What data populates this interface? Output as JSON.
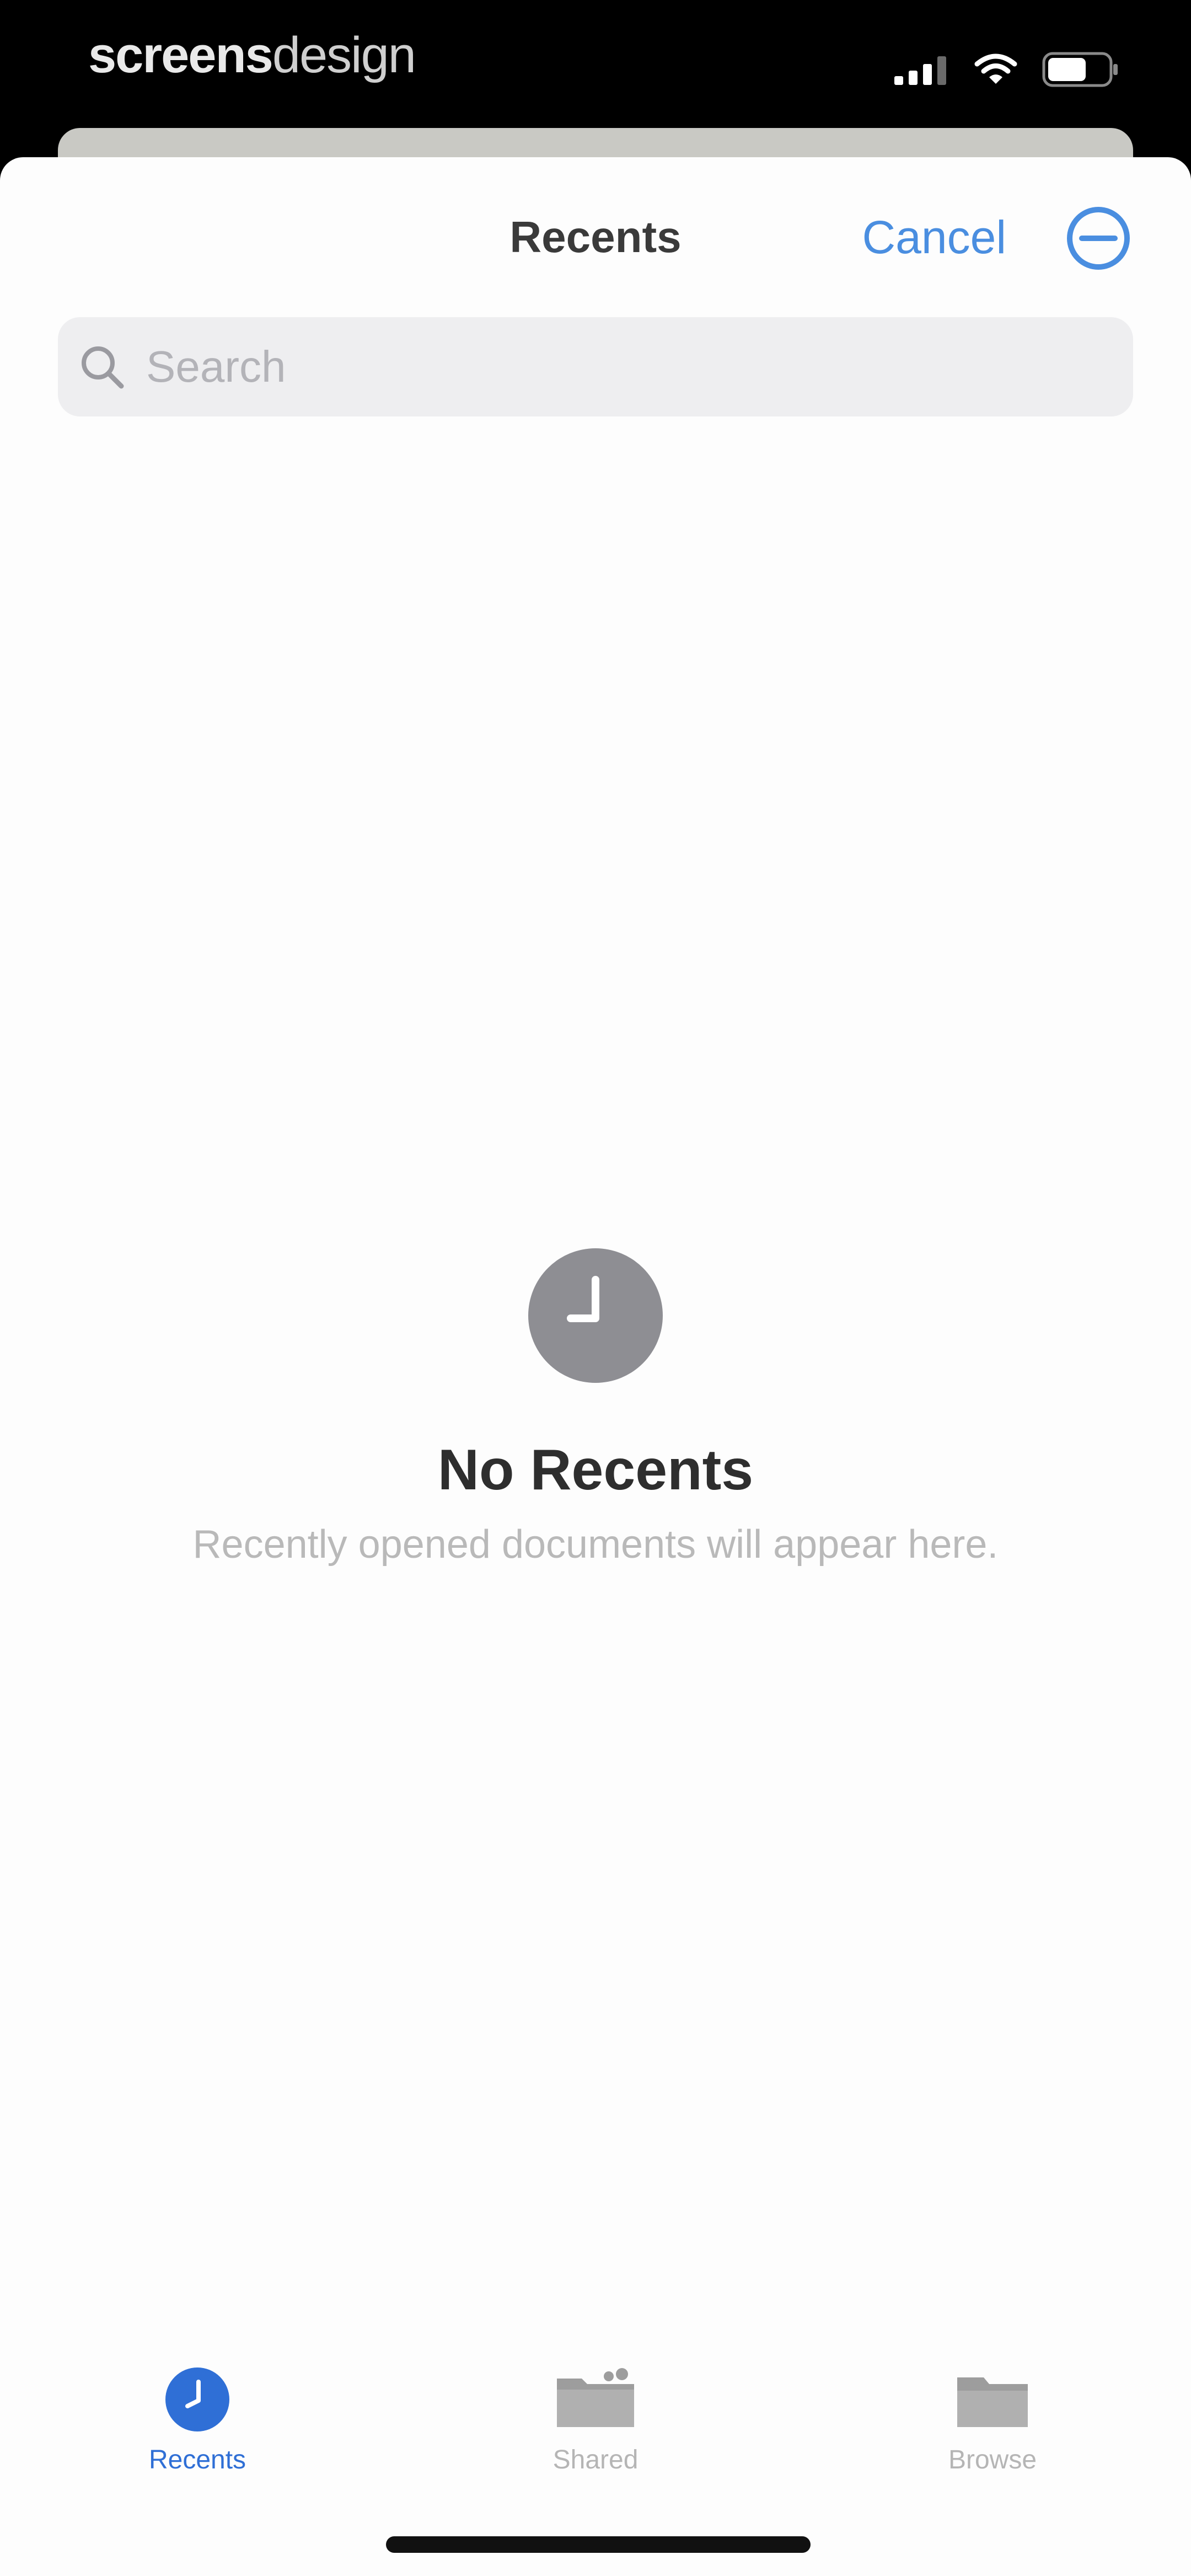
{
  "status_bar": {
    "brand_strong": "screens",
    "brand_light": "design",
    "icons": [
      "cellular-signal-icon",
      "wifi-icon",
      "battery-icon"
    ]
  },
  "nav": {
    "title": "Recents",
    "cancel_label": "Cancel",
    "more_icon": "ellipsis-circle-icon"
  },
  "search": {
    "placeholder": "Search"
  },
  "empty_state": {
    "icon": "clock-icon",
    "title": "No Recents",
    "subtitle": "Recently opened documents will appear here."
  },
  "tabs": [
    {
      "label": "Recents",
      "icon": "clock-icon",
      "selected": true
    },
    {
      "label": "Shared",
      "icon": "shared-folder-icon",
      "selected": false
    },
    {
      "label": "Browse",
      "icon": "folder-icon",
      "selected": false
    }
  ],
  "colors": {
    "accent": "#2f6fd6",
    "link": "#4a8ee0",
    "inactive": "#b5b5b5",
    "empty_icon": "#8e8e93"
  }
}
